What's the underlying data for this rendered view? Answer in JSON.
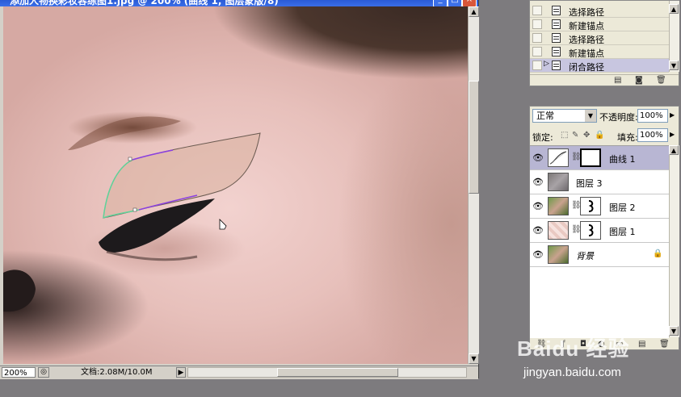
{
  "document": {
    "title": "添加人物换彩妆容练图1.jpg @ 200% (曲线 1, 图层蒙版/8)",
    "zoom": "200%",
    "doc_info": "文档:2.08M/10.0M"
  },
  "history": {
    "items": [
      {
        "label": "选择路径",
        "selected": false
      },
      {
        "label": "新建锚点",
        "selected": false
      },
      {
        "label": "选择路径",
        "selected": false
      },
      {
        "label": "新建锚点",
        "selected": false
      },
      {
        "label": "闭合路径",
        "selected": true
      }
    ]
  },
  "layers": {
    "blend_mode": "正常",
    "opacity_label": "不透明度:",
    "opacity_value": "100%",
    "lock_label": "锁定:",
    "fill_label": "填充:",
    "fill_value": "100%",
    "items": [
      {
        "name": "曲线 1",
        "selected": true
      },
      {
        "name": "图层 3",
        "selected": false
      },
      {
        "name": "图层 2",
        "selected": false
      },
      {
        "name": "图层 1",
        "selected": false
      },
      {
        "name": "背景",
        "selected": false
      }
    ]
  },
  "watermark": {
    "logo_text": "Baidu 经验",
    "url": "jingyan.baidu.com"
  },
  "colors": {
    "title_bar": "#2a5bd6",
    "selected_layer": "#b8b6d3",
    "app_background": "#7d7b7e",
    "path_stroke": "#6a5a50",
    "path_selected": "#8a40e0",
    "path_green": "#5fd39a"
  }
}
